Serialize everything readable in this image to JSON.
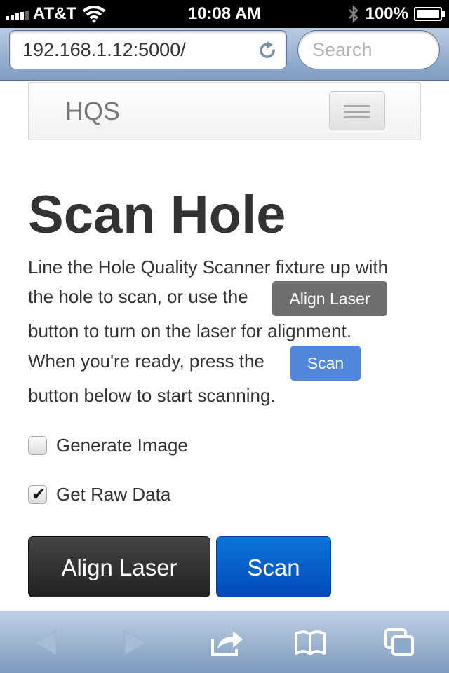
{
  "status_bar": {
    "carrier": "AT&T",
    "time": "10:08 AM",
    "battery": "100%"
  },
  "browser": {
    "url": "192.168.1.12:5000/",
    "search_placeholder": "Search"
  },
  "navbar": {
    "brand": "HQS"
  },
  "page": {
    "title": "Scan Hole",
    "para_line1": "Line the Hole Quality Scanner fixture up with",
    "para_line2": "the hole to scan, or use the",
    "align_inline": "Align Laser",
    "para_line3": "button to turn on the laser for alignment.",
    "para_line4": "When you're ready, press the",
    "scan_inline": "Scan",
    "para_line5": "button below to start scanning."
  },
  "options": [
    {
      "label": "Generate Image",
      "checked": false
    },
    {
      "label": "Get Raw Data",
      "checked": true
    }
  ],
  "buttons": {
    "align_laser": "Align Laser",
    "scan": "Scan"
  },
  "toolbar": {
    "icons": [
      "back-icon",
      "forward-icon",
      "share-icon",
      "bookmarks-icon",
      "tabs-icon"
    ]
  },
  "colors": {
    "primary_button": "#0b76d8",
    "dark_button": "#333333",
    "inline_scan": "#4f87dc",
    "inline_align": "#6f6f6f"
  }
}
